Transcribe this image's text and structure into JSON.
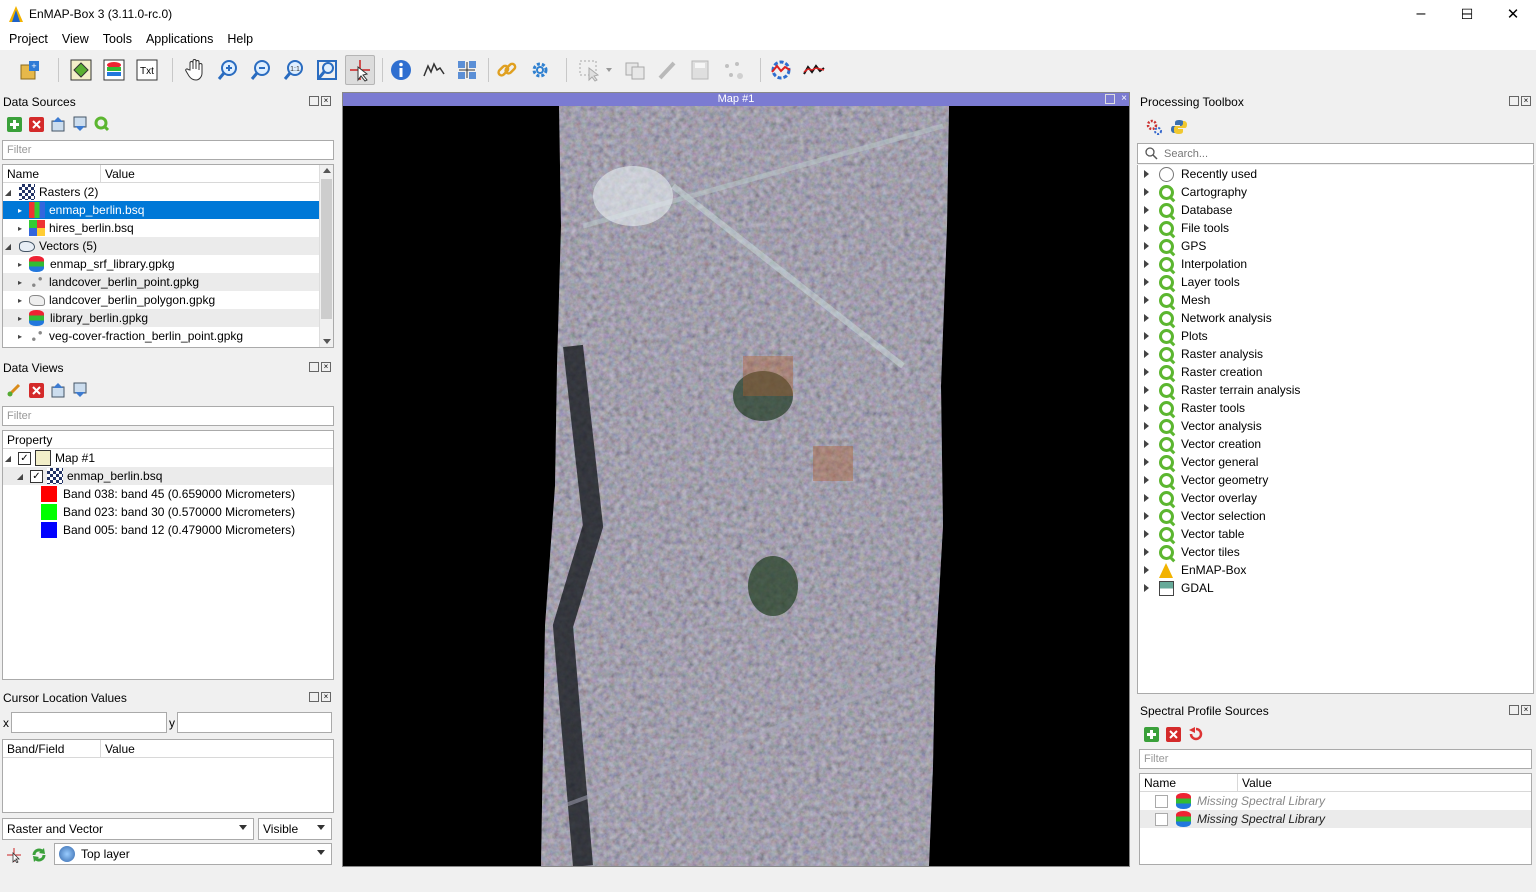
{
  "window": {
    "title": "EnMAP-Box 3 (3.11.0-rc.0)"
  },
  "menu": [
    "Project",
    "View",
    "Tools",
    "Applications",
    "Help"
  ],
  "data_sources": {
    "title": "Data Sources",
    "filter_placeholder": "Filter",
    "columns": [
      "Name",
      "Value"
    ],
    "items": [
      {
        "label": "Rasters (2)",
        "level": 0,
        "expanded": true
      },
      {
        "label": "enmap_berlin.bsq",
        "level": 1,
        "selected": true
      },
      {
        "label": "hires_berlin.bsq",
        "level": 1
      },
      {
        "label": "Vectors (5)",
        "level": 0,
        "expanded": true
      },
      {
        "label": "enmap_srf_library.gpkg",
        "level": 1
      },
      {
        "label": "landcover_berlin_point.gpkg",
        "level": 1
      },
      {
        "label": "landcover_berlin_polygon.gpkg",
        "level": 1
      },
      {
        "label": "library_berlin.gpkg",
        "level": 1
      },
      {
        "label": "veg-cover-fraction_berlin_point.gpkg",
        "level": 1
      }
    ]
  },
  "data_views": {
    "title": "Data Views",
    "filter_placeholder": "Filter",
    "column": "Property",
    "map": "Map #1",
    "layer": "enmap_berlin.bsq",
    "bands": [
      {
        "label": "Band 038: band 45 (0.659000 Micrometers)",
        "color": "#ff0000"
      },
      {
        "label": "Band 023: band 30 (0.570000 Micrometers)",
        "color": "#00ff00"
      },
      {
        "label": "Band 005: band 12 (0.479000 Micrometers)",
        "color": "#0000ff"
      }
    ]
  },
  "cursor_values": {
    "title": "Cursor Location Values",
    "x_label": "x",
    "y_label": "y",
    "columns": [
      "Band/Field",
      "Value"
    ],
    "mode": "Raster and Vector",
    "visibility": "Visible",
    "layer_mode": "Top layer"
  },
  "map": {
    "title": "Map #1"
  },
  "processing_toolbox": {
    "title": "Processing Toolbox",
    "search_placeholder": "Search...",
    "groups": [
      "Recently used",
      "Cartography",
      "Database",
      "File tools",
      "GPS",
      "Interpolation",
      "Layer tools",
      "Mesh",
      "Network analysis",
      "Plots",
      "Raster analysis",
      "Raster creation",
      "Raster terrain analysis",
      "Raster tools",
      "Vector analysis",
      "Vector creation",
      "Vector general",
      "Vector geometry",
      "Vector overlay",
      "Vector selection",
      "Vector table",
      "Vector tiles",
      "EnMAP-Box",
      "GDAL"
    ]
  },
  "spectral_sources": {
    "title": "Spectral Profile Sources",
    "filter_placeholder": "Filter",
    "columns": [
      "Name",
      "Value"
    ],
    "rows": [
      "Missing Spectral Library",
      "Missing Spectral Library"
    ]
  }
}
